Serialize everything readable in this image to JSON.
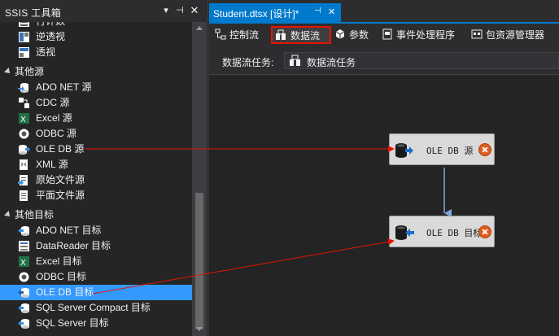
{
  "toolbox": {
    "title": "SSIS 工具箱",
    "items": [
      {
        "type": "item",
        "label": "行计数",
        "icon": "row-count-icon"
      },
      {
        "type": "item",
        "label": "逆透视",
        "icon": "unpivot-icon"
      },
      {
        "type": "item",
        "label": "透视",
        "icon": "pivot-icon"
      },
      {
        "type": "category",
        "label": "其他源"
      },
      {
        "type": "item",
        "label": "ADO NET 源",
        "icon": "ado-net-source-icon"
      },
      {
        "type": "item",
        "label": "CDC 源",
        "icon": "cdc-source-icon"
      },
      {
        "type": "item",
        "label": "Excel 源",
        "icon": "excel-source-icon"
      },
      {
        "type": "item",
        "label": "ODBC 源",
        "icon": "odbc-source-icon"
      },
      {
        "type": "item",
        "label": "OLE DB 源",
        "icon": "oledb-source-icon"
      },
      {
        "type": "item",
        "label": "XML 源",
        "icon": "xml-source-icon"
      },
      {
        "type": "item",
        "label": "原始文件源",
        "icon": "raw-file-source-icon"
      },
      {
        "type": "item",
        "label": "平面文件源",
        "icon": "flat-file-source-icon"
      },
      {
        "type": "category",
        "label": "其他目标"
      },
      {
        "type": "item",
        "label": "ADO NET 目标",
        "icon": "ado-net-destination-icon"
      },
      {
        "type": "item",
        "label": "DataReader 目标",
        "icon": "datareader-destination-icon"
      },
      {
        "type": "item",
        "label": "Excel 目标",
        "icon": "excel-destination-icon"
      },
      {
        "type": "item",
        "label": "ODBC 目标",
        "icon": "odbc-destination-icon"
      },
      {
        "type": "item",
        "label": "OLE DB 目标",
        "icon": "oledb-destination-icon",
        "selected": true
      },
      {
        "type": "item",
        "label": "SQL Server Compact 目标",
        "icon": "sql-compact-destination-icon"
      },
      {
        "type": "item",
        "label": "SQL Server 目标",
        "icon": "sql-server-destination-icon"
      }
    ]
  },
  "document": {
    "tab_title": "Student.dtsx [设计]*"
  },
  "designer_tabs": [
    {
      "label": "控制流",
      "icon": "control-flow-icon"
    },
    {
      "label": "数据流",
      "icon": "data-flow-icon",
      "active": true
    },
    {
      "label": "参数",
      "icon": "parameters-icon"
    },
    {
      "label": "事件处理程序",
      "icon": "event-handlers-icon"
    },
    {
      "label": "包资源管理器",
      "icon": "package-explorer-icon"
    }
  ],
  "task_bar": {
    "label": "数据流任务:",
    "selected_task": "数据流任务"
  },
  "canvas": {
    "nodes": [
      {
        "label": "OLE DB 源",
        "icon": "oledb-source-icon",
        "status": "error"
      },
      {
        "label": "OLE DB 目标",
        "icon": "oledb-destination-icon",
        "status": "error"
      }
    ]
  },
  "colors": {
    "accent": "#007acc",
    "selection": "#3399ff",
    "annotation": "#e51400",
    "error": "#e05c1b"
  }
}
